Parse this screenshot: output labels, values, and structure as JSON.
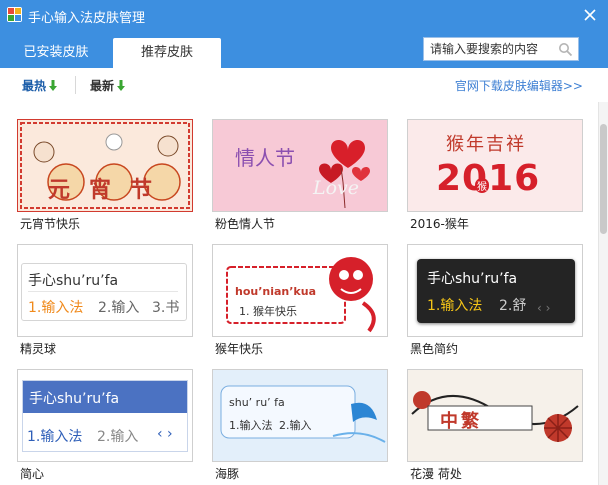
{
  "window": {
    "title": "手心输入法皮肤管理"
  },
  "tabs": [
    {
      "label": "已安装皮肤",
      "active": false
    },
    {
      "label": "推荐皮肤",
      "active": true
    }
  ],
  "search": {
    "placeholder": "请输入要搜索的内容"
  },
  "toolbar": {
    "sort_hot": "最热",
    "sort_new": "最新",
    "editor_link": "官网下载皮肤编辑器>>"
  },
  "skins": [
    {
      "name": "元宵节快乐",
      "art_text": "元宵节"
    },
    {
      "name": "粉色情人节",
      "art_text": "情人节",
      "art_sub": "Love"
    },
    {
      "name": "2016-猴年",
      "art_text": "猴年吉祥",
      "art_year": "2016",
      "art_badge": "猴"
    },
    {
      "name": "精灵球",
      "preview_input": "手心shu’ru’fa",
      "preview_c1": "1.输入法",
      "preview_c2": "2.输入",
      "preview_c3": "3.书"
    },
    {
      "name": "猴年快乐",
      "preview_input": "hou’nian’kua",
      "preview_c1": "1. 猴年快乐"
    },
    {
      "name": "黑色简约",
      "preview_input": "手心shu’ru’fa",
      "preview_c1": "1.输入法",
      "preview_c2": "2.舒"
    },
    {
      "name": "简心",
      "preview_input": "手心shu’ru’fa",
      "preview_c1": "1.输入法",
      "preview_c2": "2.输入"
    },
    {
      "name": "海豚",
      "preview_input": "shu’ ru’ fa",
      "preview_c1": "1.输入法",
      "preview_c2": "2.输入"
    },
    {
      "name": "花漫 荷处",
      "art_text": "中繁"
    }
  ],
  "colors": {
    "titlebar": "#3d8fe0",
    "sort_active": "#1a5ca8",
    "link": "#3d7fd3",
    "arrow": "#3aa632"
  }
}
